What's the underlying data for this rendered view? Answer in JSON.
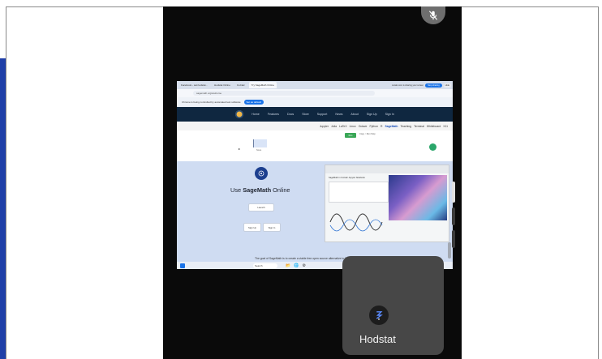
{
  "browser": {
    "tabs": [
      {
        "label": "Facebook - sat.hodstat...",
        "active": false
      },
      {
        "label": "Hodstat Online",
        "active": false
      },
      {
        "label": "CoCalc",
        "active": false
      },
      {
        "label": "Try SageMath Online",
        "active": true
      }
    ],
    "share_text": "cocalc.com is sharing your screen",
    "share_stop": "Stop sharing",
    "share_hide": "Hide",
    "url": "sagemath.org/welcome",
    "infobar_text": "Chrome is being controlled by automated test software",
    "infobar_button": "Set as default"
  },
  "site": {
    "nav": [
      "Home",
      "Features",
      "Docs",
      "Store",
      "Support",
      "News",
      "About",
      "Sign Up",
      "Sign In"
    ],
    "links": [
      "Jupyter",
      "Julia",
      "LaTeX",
      "Linux",
      "Octave",
      "Python",
      "R",
      "SageMath",
      "Teaching",
      "Terminal",
      "Whiteboard",
      "X11"
    ],
    "highlight_link": "SageMath"
  },
  "editor": {
    "run_button": "Run",
    "tools": "Copy  ↑  Run  Stop",
    "cell_text": "None"
  },
  "hero": {
    "title_prefix": "Use ",
    "title_emph": "SageMath",
    "title_suffix": " Online",
    "launch_button": "Launch",
    "signup_button": "Sign Up",
    "signin_button": "Sign In",
    "preview_title": "SageMath in CoCalc Jupyter Notebook",
    "caption": "The goal of SageMath is to create a viable free open source alternative to Magma"
  },
  "taskbar": {
    "search": "Search",
    "icons": [
      "📂",
      "🌐",
      "⚙"
    ]
  },
  "overlay": {
    "mic_icon": "mic-off-icon",
    "app_name": "Hodstat"
  },
  "colors": {
    "accent_blue": "#1a73e8",
    "site_nav": "#0f2740",
    "left_strip": "#1f3fa8",
    "phone_bg": "#0a0a0a",
    "app_card": "#474747"
  }
}
